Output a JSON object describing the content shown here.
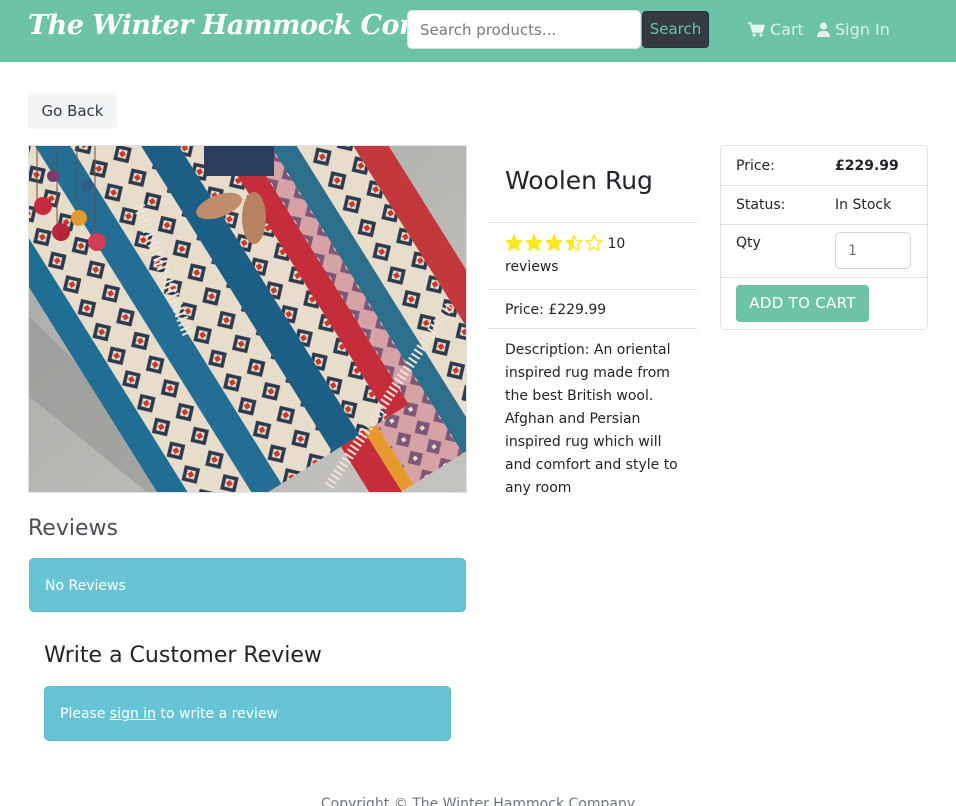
{
  "navbar": {
    "brand": "The Winter Hammock Company",
    "search_placeholder": "Search products...",
    "search_button": "Search",
    "cart_label": "Cart",
    "signin_label": "Sign In",
    "cart_icon": "shopping-cart-icon",
    "signin_icon": "user-icon",
    "background_color": "#6cc3a8"
  },
  "go_back": "Go Back",
  "product": {
    "name": "Woolen Rug",
    "rating": 3.5,
    "rating_max": 5,
    "num_reviews": "10",
    "reviews_word": "reviews",
    "price_text": "Price: £229.99",
    "description": "Description: An oriental inspired rug made from the best British wool. Afghan and Persian inspired rug which will and comfort and style to any room",
    "star_color": "#f8e825"
  },
  "cart": {
    "price_label": "Price:",
    "price_value": "£229.99",
    "status_label": "Status:",
    "status_value": "In Stock",
    "qty_label": "Qty",
    "qty_value": "1",
    "add_button": "ADD TO CART"
  },
  "reviews": {
    "heading": "Reviews",
    "empty_message": "No Reviews",
    "write_heading": "Write a Customer Review",
    "signin_prefix": "Please ",
    "signin_link": "sign in",
    "signin_suffix": " to write a review",
    "alert_color": "#67c4d4"
  },
  "footer": {
    "copyright": "Copyright © The Winter Hammock Company"
  }
}
